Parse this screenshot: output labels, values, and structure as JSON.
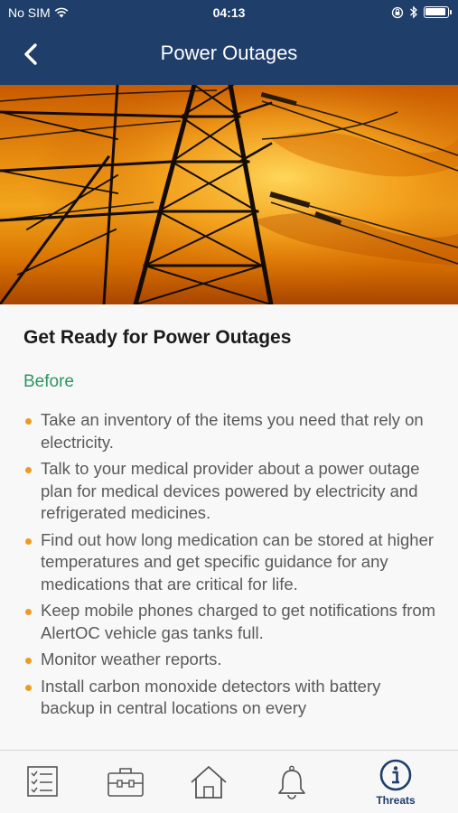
{
  "status_bar": {
    "carrier": "No SIM",
    "time": "04:13"
  },
  "nav": {
    "title": "Power Outages",
    "back_icon": "chevron-left-icon"
  },
  "article": {
    "heading": "Get Ready for Power Outages",
    "section": "Before",
    "bullets": [
      "Take an inventory of the items you need that rely on electricity.",
      "Talk to your medical provider about a power outage plan for medical devices powered by electricity and refrigerated medicines.",
      "Find out how long medication can be stored at higher temperatures and get specific guidance for any medications that are critical for life.",
      "Keep mobile phones charged to get notifications from AlertOC vehicle gas tanks full.",
      "Monitor weather reports.",
      "Install carbon monoxide detectors with battery backup in central locations on every"
    ]
  },
  "tabs": [
    {
      "icon": "checklist-icon",
      "label": ""
    },
    {
      "icon": "kit-icon",
      "label": ""
    },
    {
      "icon": "home-icon",
      "label": ""
    },
    {
      "icon": "bell-icon",
      "label": ""
    },
    {
      "icon": "info-icon",
      "label": "Threats",
      "active": true
    }
  ],
  "colors": {
    "header": "#1f3e6a",
    "section_heading": "#2f9462",
    "bullet": "#ef9a22"
  }
}
